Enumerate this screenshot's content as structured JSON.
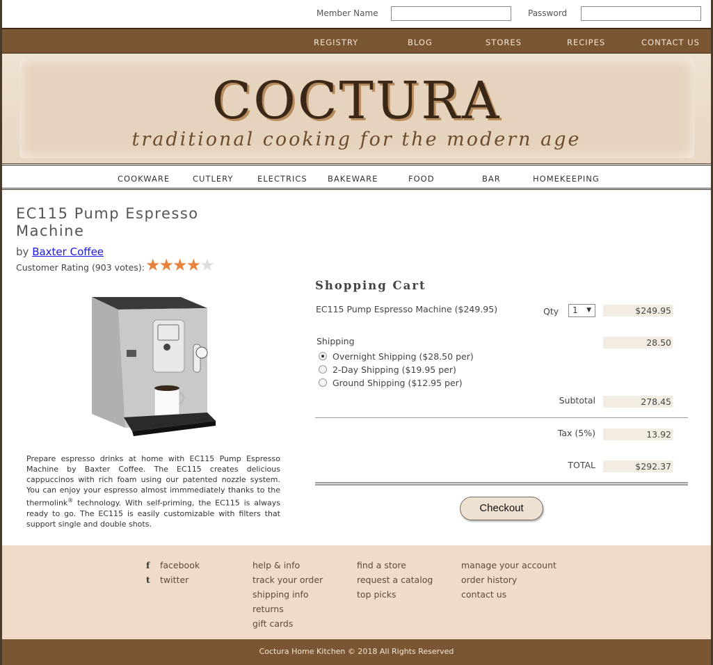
{
  "login": {
    "member_label": "Member Name",
    "password_label": "Password"
  },
  "topnav": [
    "REGISTRY",
    "BLOG",
    "STORES",
    "RECIPES",
    "CONTACT US"
  ],
  "banner": {
    "logo": "COCTURA",
    "tagline": "traditional cooking for the modern age"
  },
  "categories": [
    "COOKWARE",
    "CUTLERY",
    "ELECTRICS",
    "BAKEWARE",
    "FOOD",
    "BAR",
    "HOMEKEEPING"
  ],
  "product": {
    "title": "EC115 Pump Espresso Machine",
    "by": "by",
    "brand": "Baxter Coffee",
    "rating_text": "Customer Rating (903 votes):",
    "rating_value": 4,
    "rating_max": 5,
    "description_1": "Prepare espresso drinks at home with EC115 Pump Espresso Machine by Baxter Coffee. The EC115 creates delicious cappuccinos with rich foam using our patented nozzle system. You can enjoy your espresso almost immmediately thanks to the thermolink",
    "description_sup": "®",
    "description_2": " technology. With self-priming, the EC115 is always ready to go. The EC115 is easily customizable with filters that support single and double shots."
  },
  "cart": {
    "title": "Shopping Cart",
    "item": "EC115 Pump Espresso Machine ($249.95)",
    "qty_label": "Qty",
    "qty_value": "1",
    "item_amount": "$249.95",
    "shipping_label": "Shipping",
    "shipping_amount": "28.50",
    "shipping_options": [
      "Overnight Shipping ($28.50 per)",
      "2-Day Shipping ($19.95 per)",
      "Ground Shipping ($12.95 per)"
    ],
    "selected_shipping": 0,
    "subtotal_label": "Subtotal",
    "subtotal": "278.45",
    "tax_label": "Tax (5%)",
    "tax": "13.92",
    "total_label": "TOTAL",
    "total": "$292.37",
    "checkout_label": "Checkout"
  },
  "footer": {
    "social": [
      {
        "icon": "facebook-icon",
        "glyph": "f",
        "label": "facebook"
      },
      {
        "icon": "twitter-icon",
        "glyph": "t",
        "label": "twitter"
      }
    ],
    "col2": [
      "help & info",
      "track your order",
      "shipping info",
      "returns",
      "gift cards"
    ],
    "col3": [
      "find a store",
      "request a catalog",
      "top picks"
    ],
    "col4": [
      "manage your account",
      "order history",
      "contact us"
    ],
    "copyright": "Coctura Home Kitchen © 2018 All Rights Reserved"
  },
  "colors": {
    "brown": "#7b5632",
    "cream": "#efdbc8",
    "star": "#e8813a"
  }
}
